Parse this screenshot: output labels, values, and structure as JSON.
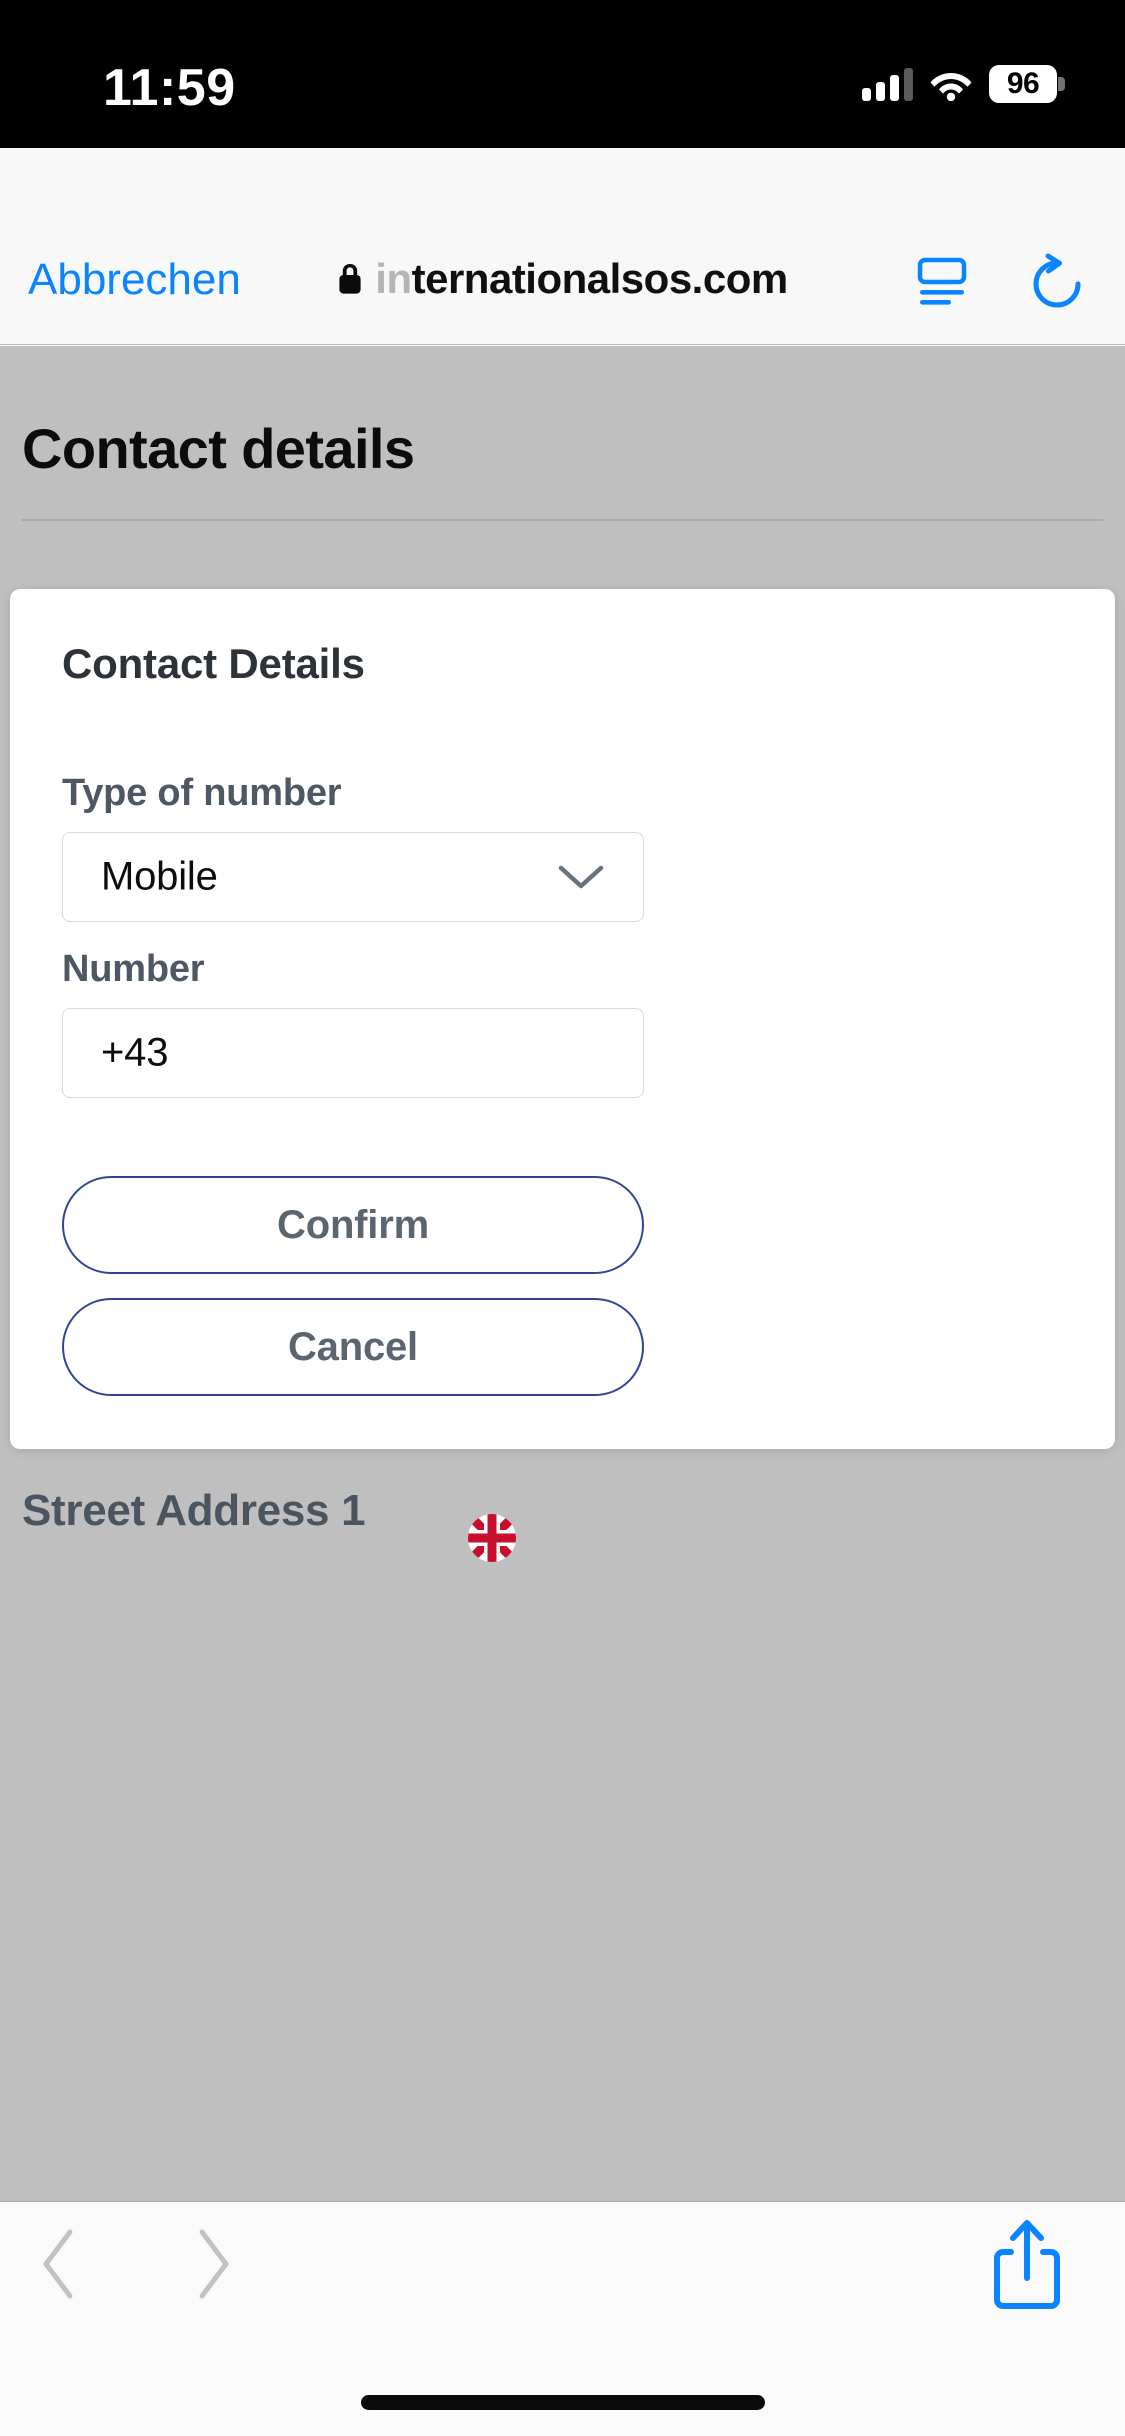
{
  "status_bar": {
    "time": "11:59",
    "battery_percent": "96",
    "signal_icon": "cellular-signal-icon",
    "wifi_icon": "wifi-icon",
    "battery_icon": "battery-icon"
  },
  "browser": {
    "cancel_label": "Abbrechen",
    "url_faded_prefix": "in",
    "url_visible": "ternationalsos.com",
    "lock_icon": "lock-icon",
    "reader_icon": "reader-view-icon",
    "reload_icon": "reload-icon"
  },
  "page": {
    "title": "Contact details",
    "footer_label": "Street Address 1",
    "flag_icon": "uk-flag-icon"
  },
  "modal": {
    "title": "Contact Details",
    "fields": [
      {
        "label": "Type of number",
        "type": "select",
        "value": "Mobile",
        "icon": "chevron-down-icon"
      },
      {
        "label": "Number",
        "type": "text",
        "value": "+43",
        "placeholder": ""
      }
    ],
    "confirm_label": "Confirm",
    "cancel_label": "Cancel"
  },
  "bottom_bar": {
    "back_icon": "chevron-left-icon",
    "forward_icon": "chevron-right-icon",
    "share_icon": "share-icon",
    "home_indicator": "home-indicator"
  },
  "colors": {
    "ios_blue": "#0a84ff",
    "brand_blue": "#2f4694",
    "label_slate": "#4e5864",
    "page_overlay": "#bfbfbf"
  }
}
